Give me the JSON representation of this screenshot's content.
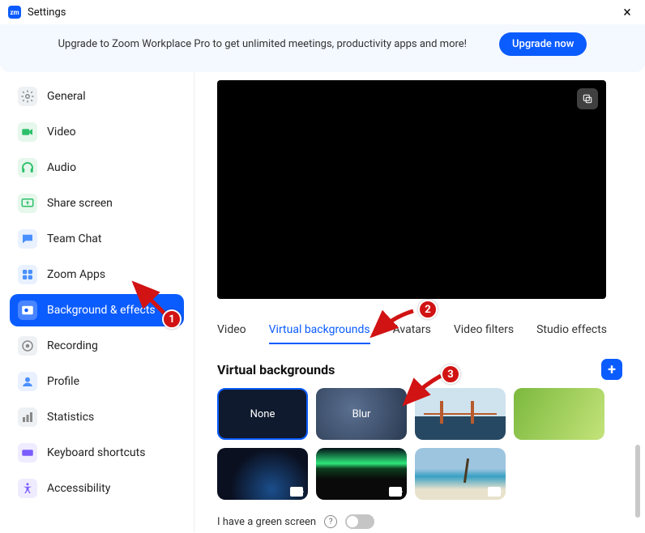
{
  "window": {
    "title": "Settings"
  },
  "promo": {
    "text": "Upgrade to Zoom Workplace Pro to get unlimited meetings, productivity apps and more!",
    "button": "Upgrade now"
  },
  "sidebar": {
    "items": [
      {
        "label": "General",
        "icon": "gear-icon"
      },
      {
        "label": "Video",
        "icon": "video-icon"
      },
      {
        "label": "Audio",
        "icon": "headphones-icon"
      },
      {
        "label": "Share screen",
        "icon": "share-screen-icon"
      },
      {
        "label": "Team Chat",
        "icon": "chat-icon"
      },
      {
        "label": "Zoom Apps",
        "icon": "apps-icon"
      },
      {
        "label": "Background & effects",
        "icon": "background-effects-icon",
        "active": true
      },
      {
        "label": "Recording",
        "icon": "recording-icon"
      },
      {
        "label": "Profile",
        "icon": "profile-icon"
      },
      {
        "label": "Statistics",
        "icon": "statistics-icon"
      },
      {
        "label": "Keyboard shortcuts",
        "icon": "keyboard-icon"
      },
      {
        "label": "Accessibility",
        "icon": "accessibility-icon"
      }
    ]
  },
  "content": {
    "tabs": [
      {
        "label": "Video"
      },
      {
        "label": "Virtual backgrounds",
        "active": true
      },
      {
        "label": "Avatars"
      },
      {
        "label": "Video filters"
      },
      {
        "label": "Studio effects"
      }
    ],
    "section_title": "Virtual backgrounds",
    "backgrounds": {
      "none_label": "None",
      "blur_label": "Blur"
    },
    "green_screen_label": "I have a green screen"
  },
  "annotations": {
    "badge1": "1",
    "badge2": "2",
    "badge3": "3"
  }
}
